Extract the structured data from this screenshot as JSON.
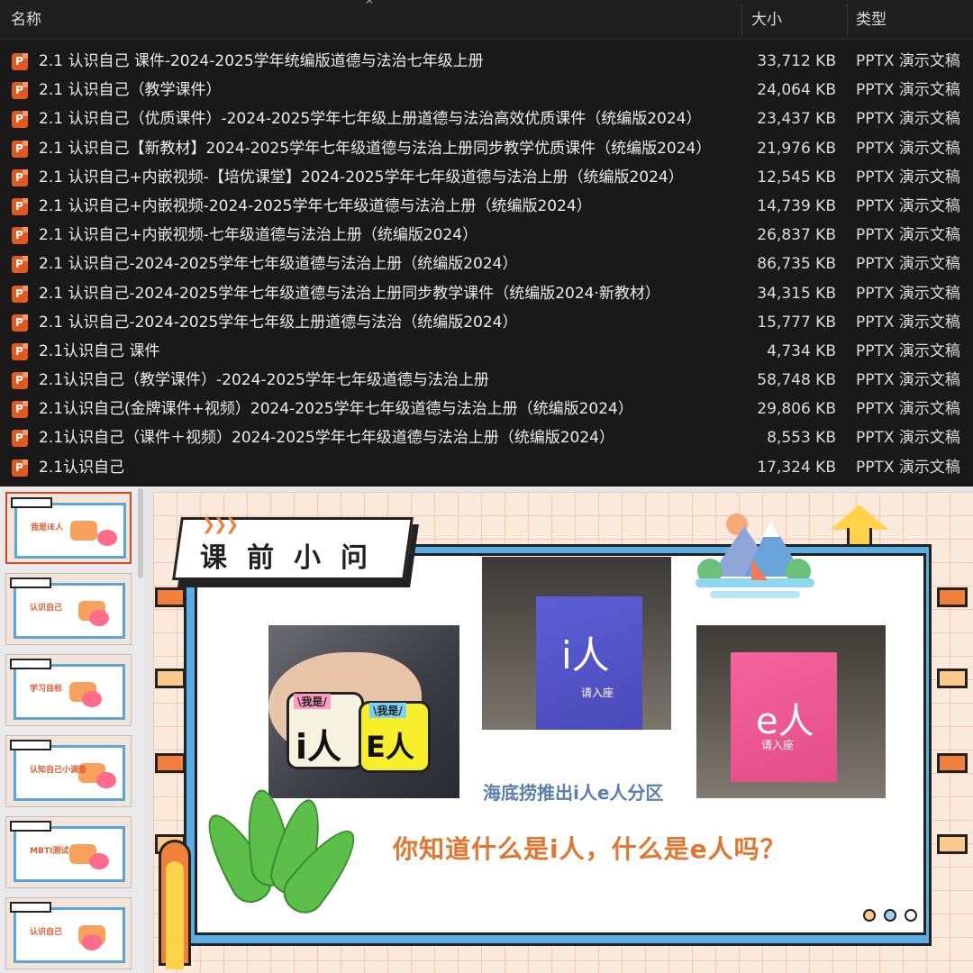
{
  "explorer": {
    "columns": {
      "name": "名称",
      "size": "大小",
      "type": "类型"
    },
    "files": [
      {
        "name": "2.1 认识自己 课件-2024-2025学年统编版道德与法治七年级上册",
        "size": "33,712 KB",
        "type": "PPTX 演示文稿"
      },
      {
        "name": "2.1 认识自己（教学课件）",
        "size": "24,064 KB",
        "type": "PPTX 演示文稿"
      },
      {
        "name": "2.1 认识自己（优质课件）-2024-2025学年七年级上册道德与法治高效优质课件（统编版2024）",
        "size": "23,437 KB",
        "type": "PPTX 演示文稿"
      },
      {
        "name": "2.1 认识自己【新教材】2024-2025学年七年级道德与法治上册同步教学优质课件（统编版2024）",
        "size": "21,976 KB",
        "type": "PPTX 演示文稿"
      },
      {
        "name": "2.1 认识自己+内嵌视频-【培优课堂】2024-2025学年七年级道德与法治上册（统编版2024）",
        "size": "12,545 KB",
        "type": "PPTX 演示文稿"
      },
      {
        "name": "2.1 认识自己+内嵌视频-2024-2025学年七年级道德与法治上册（统编版2024）",
        "size": "14,739 KB",
        "type": "PPTX 演示文稿"
      },
      {
        "name": "2.1 认识自己+内嵌视频-七年级道德与法治上册（统编版2024）",
        "size": "26,837 KB",
        "type": "PPTX 演示文稿"
      },
      {
        "name": "2.1 认识自己-2024-2025学年七年级道德与法治上册（统编版2024）",
        "size": "86,735 KB",
        "type": "PPTX 演示文稿"
      },
      {
        "name": "2.1 认识自己-2024-2025学年七年级道德与法治上册同步教学课件（统编版2024·新教材）",
        "size": "34,315 KB",
        "type": "PPTX 演示文稿"
      },
      {
        "name": "2.1 认识自己-2024-2025学年七年级上册道德与法治（统编版2024）",
        "size": "15,777 KB",
        "type": "PPTX 演示文稿"
      },
      {
        "name": "2.1认识自己 课件",
        "size": "4,734 KB",
        "type": "PPTX 演示文稿"
      },
      {
        "name": "2.1认识自己（教学课件）-2024-2025学年七年级道德与法治上册",
        "size": "58,748 KB",
        "type": "PPTX 演示文稿"
      },
      {
        "name": "2.1认识自己(金牌课件+视频）2024-2025学年七年级道德与法治上册（统编版2024）",
        "size": "29,806 KB",
        "type": "PPTX 演示文稿"
      },
      {
        "name": "2.1认识自己（课件＋视频）2024-2025学年七年级道德与法治上册（统编版2024）",
        "size": "8,553 KB",
        "type": "PPTX 演示文稿"
      },
      {
        "name": "2.1认识自己",
        "size": "17,324 KB",
        "type": "PPTX 演示文稿"
      }
    ]
  },
  "thumbnails": [
    {
      "label": "我是iE人",
      "active": true
    },
    {
      "label": "认识自己",
      "active": false
    },
    {
      "label": "学习目标",
      "active": false
    },
    {
      "label": "认知自己小调查",
      "active": false
    },
    {
      "label": "MBTI测试",
      "active": false
    },
    {
      "label": "认识自己",
      "active": false
    }
  ],
  "slide": {
    "title": "课前小问",
    "photo1": {
      "tag_i": "\\我是/",
      "text_i": "i人",
      "tag_e": "\\我是/",
      "text_e": "E人"
    },
    "photo2": {
      "sign": "i人",
      "sub": "请入座"
    },
    "photo3": {
      "sign": "e人",
      "sub": "请入座"
    },
    "caption": "海底捞推出i人e人分区",
    "question": "你知道什么是i人，什么是e人吗？"
  },
  "colors": {
    "accent_orange": "#f0803c",
    "frame_blue": "#5aaee3",
    "question_orange": "#e2762f",
    "caption_blue": "#5a7fae"
  }
}
